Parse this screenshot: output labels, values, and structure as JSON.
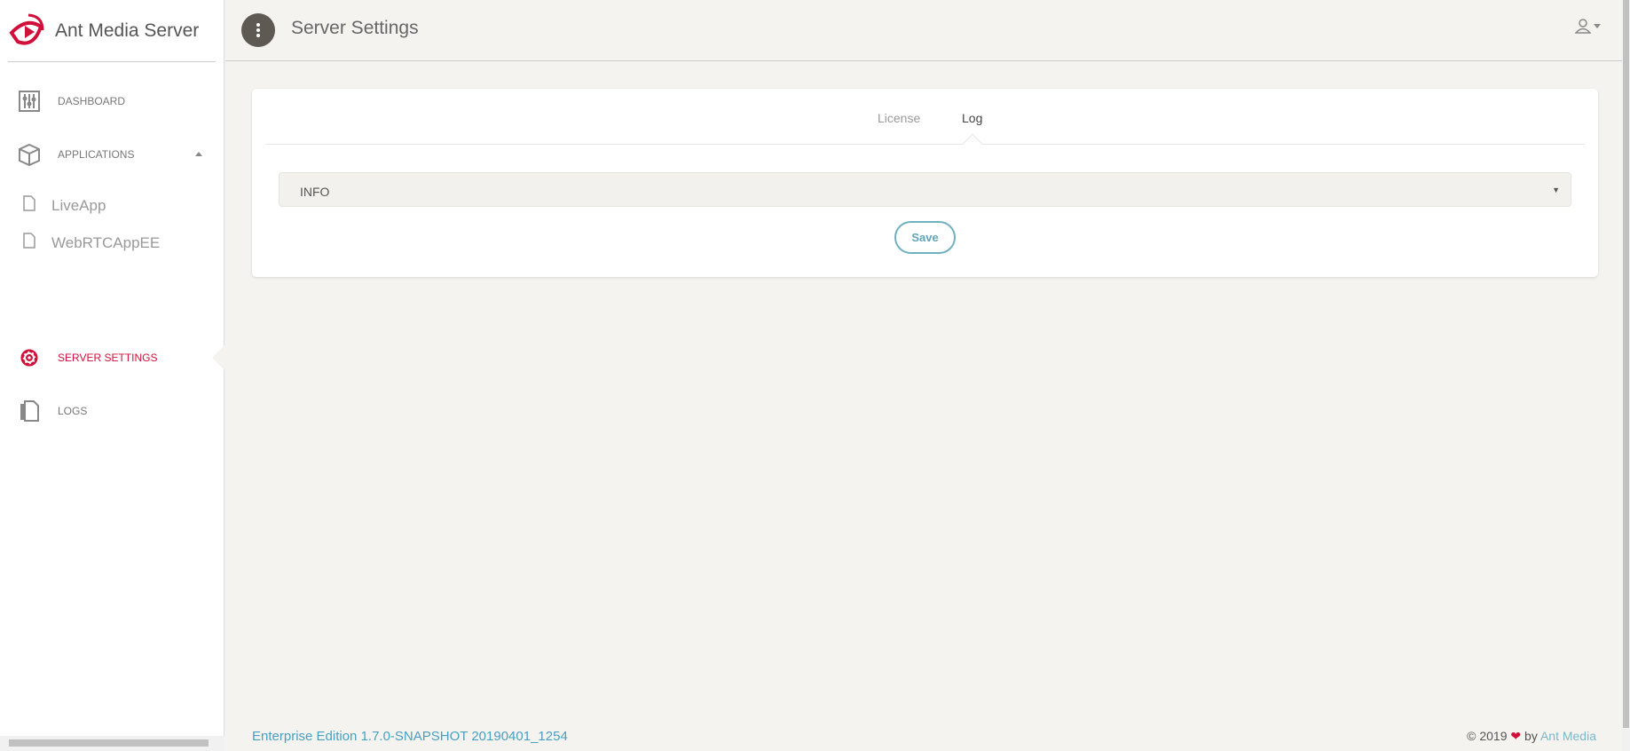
{
  "app": {
    "name": "Ant Media Server",
    "accent": "#d0103a"
  },
  "sidebar": {
    "items": [
      {
        "label": "DASHBOARD",
        "icon": "sliders-icon"
      },
      {
        "label": "APPLICATIONS",
        "icon": "box-icon"
      },
      {
        "label": "SERVER SETTINGS",
        "icon": "gear-icon",
        "active": true
      },
      {
        "label": "LOGS",
        "icon": "document-icon"
      }
    ],
    "apps": [
      {
        "label": "LiveApp"
      },
      {
        "label": "WebRTCAppEE"
      }
    ]
  },
  "header": {
    "title": "Server Settings"
  },
  "main": {
    "tabs": [
      {
        "label": "License"
      },
      {
        "label": "Log",
        "active": true
      }
    ],
    "log_level": {
      "value": "INFO"
    },
    "save_label": "Save"
  },
  "footer": {
    "edition": "Enterprise Edition 1.7.0-SNAPSHOT 20190401_1254",
    "copyright": "© 2019",
    "by": "by",
    "company": "Ant Media"
  }
}
